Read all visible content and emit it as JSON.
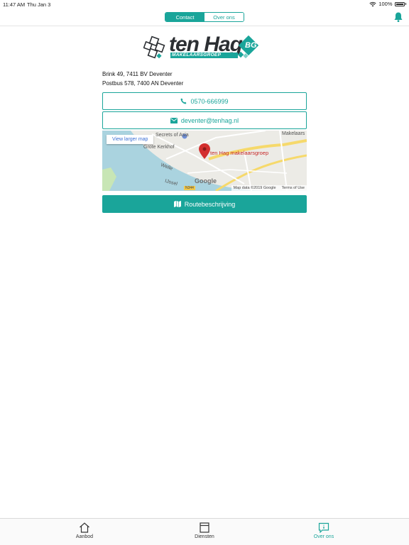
{
  "status": {
    "time": "11:47 AM",
    "date": "Thu Jan 3",
    "battery": "100%"
  },
  "nav": {
    "segments": [
      "Contact",
      "Over ons"
    ],
    "selected": "Contact"
  },
  "logo": {
    "name": "ten Hag",
    "subtitle": "MAKELAARSGROEP",
    "mark": "BG"
  },
  "address": {
    "line1": "Brink 49, 7411 BV Deventer",
    "line2": "Postbus 578, 7400 AN Deventer"
  },
  "contact": {
    "phone": "0570-666999",
    "email": "deventer@tenhag.nl"
  },
  "map": {
    "view_larger": "View larger map",
    "pin_label": "ten Hag makelaarsgroep",
    "labels": [
      "Secrets of Asia",
      "Grote Kerkhof",
      "Makelaars",
      "Welle",
      "IJssel",
      "N344"
    ],
    "brand": "Google",
    "data_credit": "Map data ©2019 Google",
    "terms": "Terms of Use"
  },
  "route_button": "Routebeschrijving",
  "tabs": [
    {
      "label": "Aanbod",
      "icon": "home-icon"
    },
    {
      "label": "Diensten",
      "icon": "box-icon"
    },
    {
      "label": "Over ons",
      "icon": "info-chat-icon"
    }
  ],
  "active_tab": "Over ons",
  "colors": {
    "accent": "#1aa59a",
    "pin": "#c62828"
  }
}
